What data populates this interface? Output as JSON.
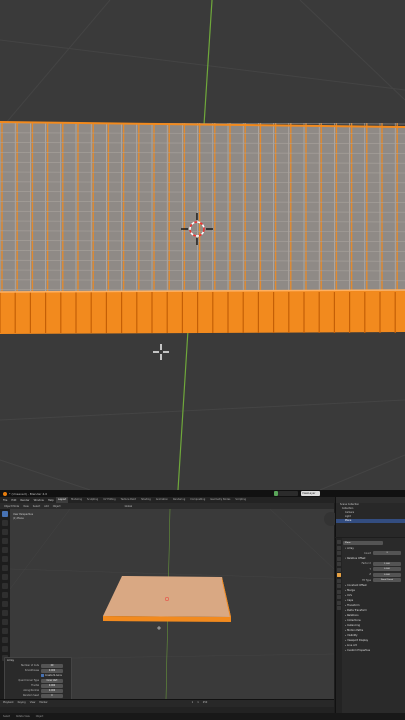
{
  "window": {
    "title": "* (Unsaved) - Blender 4.0",
    "scene_label": "Scene",
    "view_layer_label": "ViewLayer"
  },
  "menus": [
    "File",
    "Edit",
    "Render",
    "Window",
    "Help"
  ],
  "workspace_tabs": [
    "Layout",
    "Modeling",
    "Sculpting",
    "UV Editing",
    "Texture Paint",
    "Shading",
    "Animation",
    "Rendering",
    "Compositing",
    "Geometry Nodes",
    "Scripting"
  ],
  "active_workspace": "Layout",
  "viewport_header": {
    "mode": "Object Mode",
    "items": [
      "View",
      "Select",
      "Add",
      "Object"
    ],
    "transform": "Global"
  },
  "viewport_overlay": {
    "perspective": "User Perspective",
    "collection": "(1) Plane"
  },
  "operator_panel": {
    "title": "Array",
    "rows": [
      {
        "label": "Number of Cuts",
        "value": "29"
      },
      {
        "label": "Smoothness",
        "value": "0.000"
      },
      {
        "label": "",
        "value": "",
        "checkbox": "Create N-Gons"
      },
      {
        "label": "Quad Corner Type",
        "value": "Inner Vert"
      },
      {
        "label": "Fractal",
        "value": "0.000"
      },
      {
        "label": "Along Normal",
        "value": "0.000"
      },
      {
        "label": "Random Seed",
        "value": "0"
      }
    ]
  },
  "timeline": {
    "items": [
      "Playback",
      "Keying",
      "View",
      "Marker"
    ],
    "current_frame": "1",
    "start": "1",
    "end": "250"
  },
  "status_bar": {
    "items": [
      "Select",
      "Rotate View",
      "Object"
    ]
  },
  "activate_windows": {
    "line1": "Activate Windows",
    "line2": "Go to Settings to activate Windows."
  },
  "outliner": {
    "rows": [
      "Scene Collection",
      "Collection",
      "Camera",
      "Light",
      "Plane"
    ],
    "selected": "Plane"
  },
  "properties": {
    "object_name": "Plane",
    "modifier": "Array",
    "sections": [
      {
        "label": "Relative Offset",
        "open": true
      },
      {
        "label": "Constant Offset",
        "open": false
      },
      {
        "label": "Merge",
        "open": false
      },
      {
        "label": "UVs",
        "open": false
      },
      {
        "label": "Caps",
        "open": false
      }
    ],
    "fields": [
      {
        "label": "Count",
        "value": "3"
      },
      {
        "label": "Factor X",
        "value": "1.000"
      },
      {
        "label": "Y",
        "value": "0.000"
      },
      {
        "label": "Z",
        "value": "0.000"
      },
      {
        "label": "Fit Type",
        "value": "Fixed Count"
      }
    ],
    "lower_sections": [
      "Transform",
      "Delta Transform",
      "Relations",
      "Collections",
      "Instancing",
      "Motion Paths",
      "Visibility",
      "Viewport Display",
      "Line Art",
      "Custom Properties"
    ]
  },
  "colors": {
    "accent_orange": "#f28a1e",
    "mesh_face": "#8f8a86",
    "viewport_bg": "#3a3a3a",
    "y_axis": "#6fa83a",
    "selection_blue": "#4772b3"
  }
}
